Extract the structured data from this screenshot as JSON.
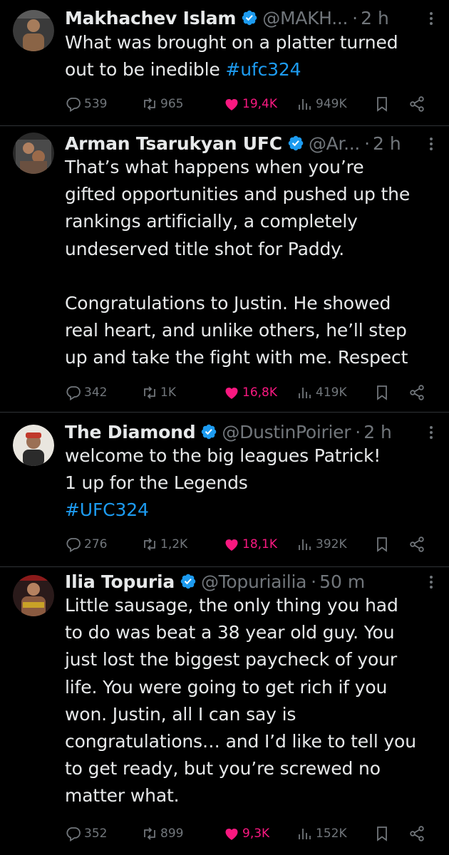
{
  "tweets": [
    {
      "name": "Makhachev Islam",
      "handle": "@MAKH...",
      "time": "2 h",
      "text_parts": [
        {
          "text": "What was brought on a platter turned\nout to be inedible "
        },
        {
          "text": "#ufc324",
          "tag": true
        }
      ],
      "replies": "539",
      "retweets": "965",
      "likes": "19,4K",
      "views": "949K"
    },
    {
      "name": "Arman Tsarukyan UFC",
      "handle": "@Ar...",
      "time": "2 h",
      "text_parts": [
        {
          "text": "That’s what happens when you’re\ngifted opportunities and pushed up the\nrankings artificially, a completely\nundeserved title shot for Paddy.\n\nCongratulations to Justin. He showed\nreal heart, and unlike others, he’ll step\nup and take the fight with me. Respect"
        }
      ],
      "replies": "342",
      "retweets": "1K",
      "likes": "16,8K",
      "views": "419K"
    },
    {
      "name": "The Diamond",
      "handle": "@DustinPoirier",
      "time": "2 h",
      "text_parts": [
        {
          "text": "welcome to the big leagues Patrick!\n1 up for the Legends\n"
        },
        {
          "text": "#UFC324",
          "tag": true
        }
      ],
      "replies": "276",
      "retweets": "1,2K",
      "likes": "18,1K",
      "views": "392K"
    },
    {
      "name": "Ilia Topuria",
      "handle": "@Topuriailia",
      "time": "50 m",
      "text_parts": [
        {
          "text": "Little sausage, the only thing you had\nto do was beat a 38 year old guy. You\njust lost the biggest paycheck of your\nlife. You were going to get rich if you\nwon. Justin, all I can say is\ncongratulations… and I’d like to tell you\nto get ready, but you’re screwed no\nmatter what."
        }
      ],
      "replies": "352",
      "retweets": "899",
      "likes": "9,3K",
      "views": "152K"
    }
  ],
  "colors": {
    "background": "#000000",
    "text": "#e7e9ea",
    "muted": "#71767b",
    "link": "#1d9bf0",
    "like": "#f91880",
    "verified": "#1d9bf0"
  },
  "icons": [
    "verified-icon",
    "more-icon",
    "reply-icon",
    "retweet-icon",
    "heart-filled-icon",
    "views-icon",
    "bookmark-icon",
    "share-icon"
  ]
}
